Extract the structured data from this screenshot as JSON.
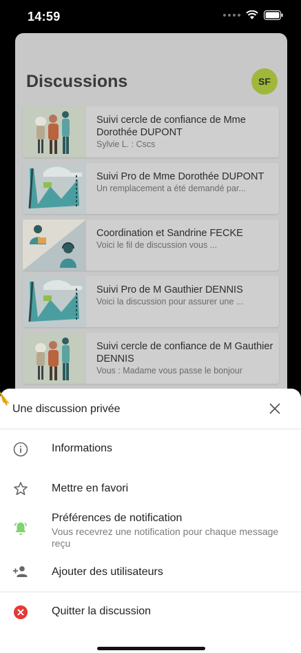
{
  "status": {
    "time": "14:59"
  },
  "header": {
    "title": "Discussions",
    "avatar_initials": "SF",
    "avatar_color": "#9fb83a"
  },
  "conversations": [
    {
      "title": "Suivi cercle de confiance de Mme Dorothée DUPONT",
      "subtitle": "Sylvie L. : Cscs",
      "illustration": "family-group"
    },
    {
      "title": "Suivi Pro de Mme Dorothée DUPONT",
      "subtitle": "Un remplacement a été demandé par...",
      "illustration": "pro-tools"
    },
    {
      "title": "Coordination et Sandrine FECKE",
      "subtitle": "Voici le fil de discussion vous ...",
      "illustration": "coordination"
    },
    {
      "title": "Suivi Pro de M Gauthier DENNIS",
      "subtitle": "Voici la discussion pour assurer une ...",
      "illustration": "pro-tools"
    },
    {
      "title": "Suivi cercle de confiance de M Gauthier DENNIS",
      "subtitle": "Vous : Madame vous passe le bonjour",
      "illustration": "family-group"
    }
  ],
  "sheet": {
    "title": "Une discussion privée",
    "items": [
      {
        "label": "Informations",
        "icon": "info-icon"
      },
      {
        "label": "Mettre en favori",
        "icon": "star-outline-icon"
      },
      {
        "label": "Préférences de notification",
        "sub": "Vous recevrez une notification pour chaque message reçu",
        "icon": "bell-ring-icon",
        "icon_color": "#7ed56f"
      },
      {
        "label": "Ajouter des utilisateurs",
        "icon": "add-person-icon"
      },
      {
        "label": "Quitter la discussion",
        "icon": "close-circle-icon",
        "icon_color": "#e53935"
      }
    ]
  }
}
